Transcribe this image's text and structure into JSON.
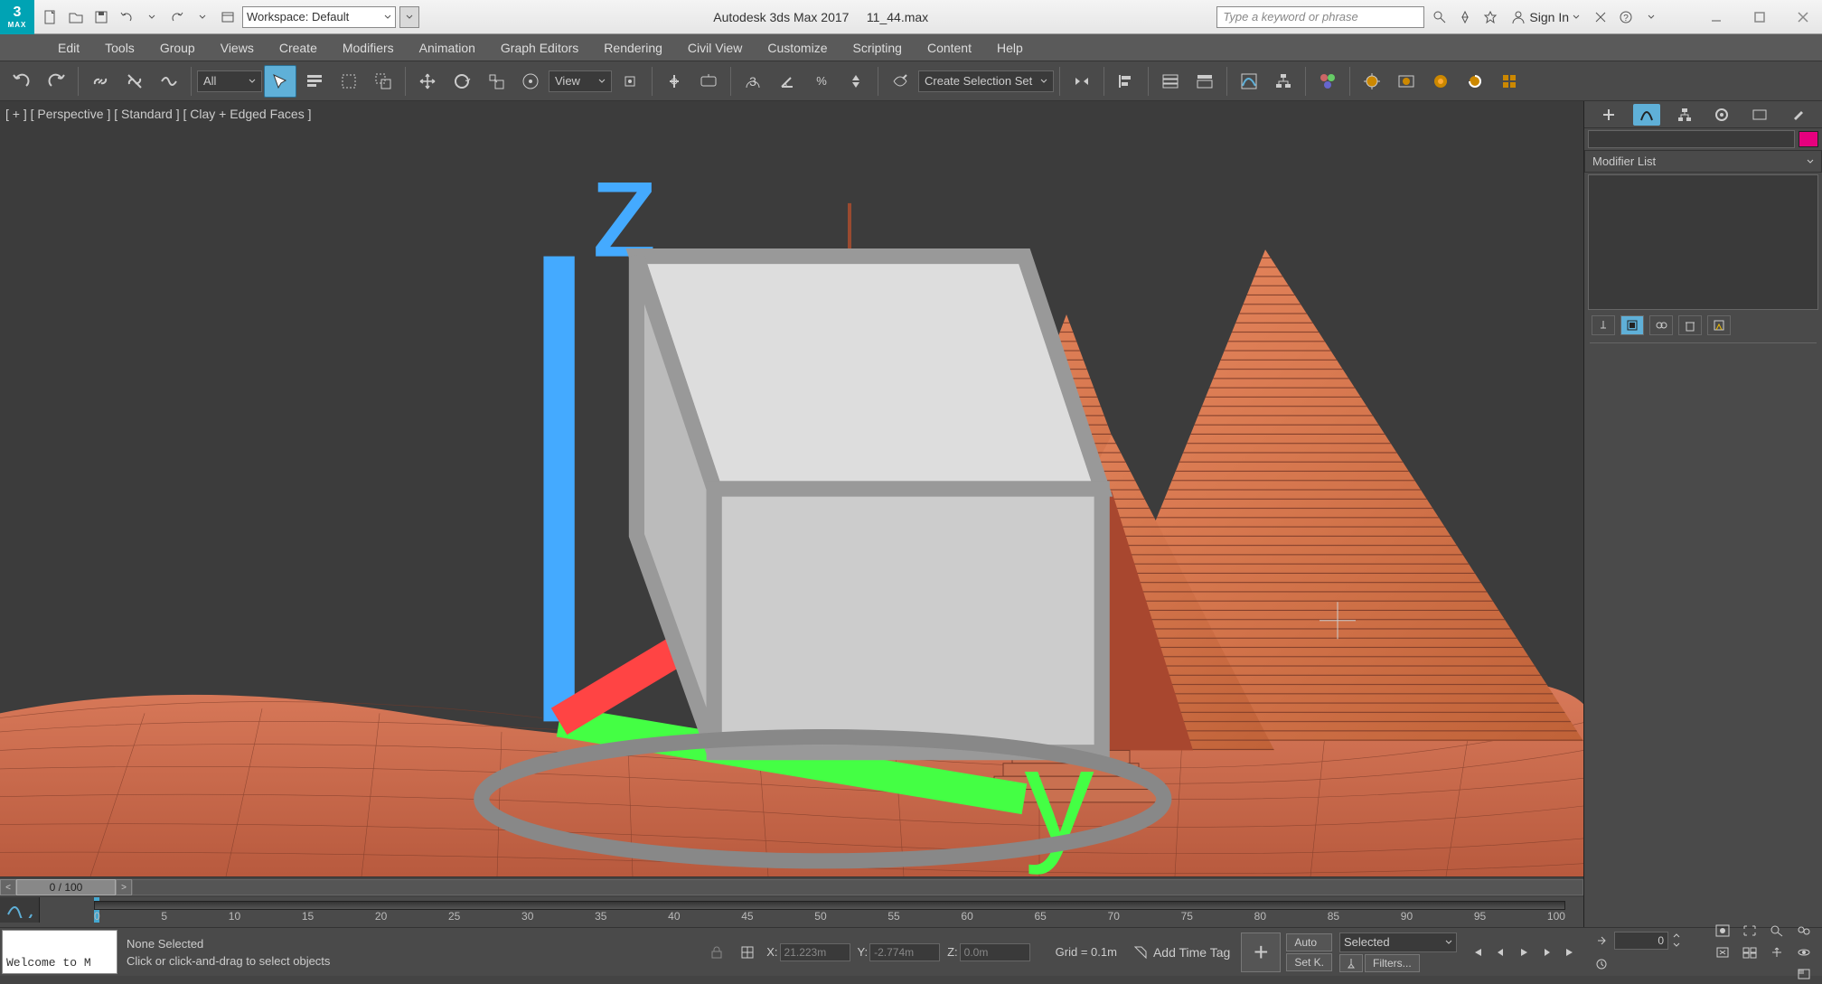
{
  "titlebar": {
    "app_icon_top": "3",
    "app_icon_bottom": "MAX",
    "workspace_label": "Workspace: Default",
    "app_title": "Autodesk 3ds Max 2017",
    "file_name": "11_44.max",
    "search_placeholder": "Type a keyword or phrase",
    "signin_label": "Sign In"
  },
  "menu": [
    "Edit",
    "Tools",
    "Group",
    "Views",
    "Create",
    "Modifiers",
    "Animation",
    "Graph Editors",
    "Rendering",
    "Civil View",
    "Customize",
    "Scripting",
    "Content",
    "Help"
  ],
  "toolbar": {
    "filter_label": "All",
    "view_label": "View",
    "selectionset_label": "Create Selection Set"
  },
  "viewport": {
    "label": "[ + ] [ Perspective ] [ Standard ] [ Clay + Edged Faces ]"
  },
  "cmdpanel": {
    "modifier_list_label": "Modifier List"
  },
  "timeslider": {
    "label": "0 / 100"
  },
  "timeline_ticks": [
    "0",
    "5",
    "10",
    "15",
    "20",
    "25",
    "30",
    "35",
    "40",
    "45",
    "50",
    "55",
    "60",
    "65",
    "70",
    "75",
    "80",
    "85",
    "90",
    "95",
    "100"
  ],
  "status": {
    "selection": "None Selected",
    "prompt": "Click or click-and-drag to select objects",
    "maxscript": "Welcome to M",
    "x_label": "X:",
    "x_val": "21.223m",
    "y_label": "Y:",
    "y_val": "-2.774m",
    "z_label": "Z:",
    "z_val": "0.0m",
    "grid": "Grid = 0.1m",
    "timetag": "Add Time Tag"
  },
  "anim": {
    "auto": "Auto",
    "setkey": "Set K.",
    "selected": "Selected",
    "filters": "Filters...",
    "frame": "0"
  }
}
